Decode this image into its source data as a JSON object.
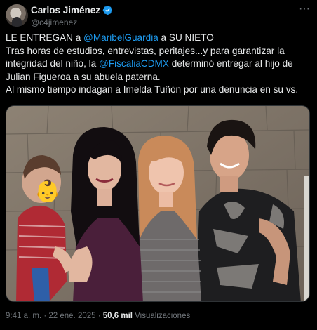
{
  "author": {
    "display_name": "Carlos Jiménez",
    "handle": "@c4jimenez",
    "verified": true
  },
  "tweet": {
    "line1": {
      "pre": "LE ENTREGAN a ",
      "mention": "@MaribelGuardia",
      "post": " a SU NIETO"
    },
    "line2": "Tras horas de estudios, entrevistas, peritajes...y para garantizar la",
    "line3": {
      "pre": "integridad del niño, la ",
      "mention": "@FiscaliaCDMX",
      "post": " determinó entregar al hijo de"
    },
    "line4": "Julian Figueroa a su abuela paterna.",
    "line5": "Al mismo tiempo indagan a Imelda Tuñón por una denuncia en su vs."
  },
  "media": {
    "baby_emoji": "👶"
  },
  "meta": {
    "time": "9:41 a. m.",
    "separator": " · ",
    "date": "22 ene. 2025",
    "views_count": "50,6 mil",
    "views_label": "Visualizaciones"
  },
  "colors": {
    "background": "#000000",
    "text": "#e7e9ea",
    "secondary": "#71767b",
    "accent": "#1d9bf0"
  }
}
